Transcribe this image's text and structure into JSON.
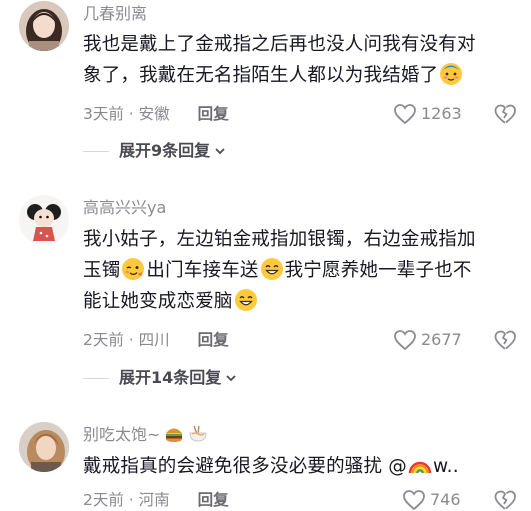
{
  "comments": [
    {
      "username": "几春别离",
      "text1": "我也是戴上了金戒指之后再也没人问我有没有对",
      "text2": "象了，我戴在无名指陌生人都以为我结婚了",
      "time_location": "3天前 · 安徽",
      "reply_label": "回复",
      "likes": "1263",
      "expand_label": "展开9条回复",
      "emoji": [
        "blush-face-emoji"
      ]
    },
    {
      "username": "高高兴兴ya",
      "text1": "我小姑子，左边铂金戒指加银镯，右边金戒指加",
      "text2a": "玉镯",
      "text2b": "出门车接车送",
      "text2c": "我宁愿养她一辈子也不",
      "text3": "能让她变成恋爱脑",
      "time_location": "2天前 · 四川",
      "reply_label": "回复",
      "likes": "2677",
      "expand_label": "展开14条回复",
      "emoji": [
        "wink-face-emoji",
        "grin-face-emoji",
        "grin-face-emoji"
      ]
    },
    {
      "username": "别吃太饱~",
      "username_emoji": [
        "burger-emoji",
        "noodle-bowl-emoji"
      ],
      "text1": "戴戒指真的会避免很多没必要的骚扰 @",
      "text1_tail": "w..",
      "time_location": "2天前 · 河南",
      "reply_label": "回复",
      "likes": "746",
      "emoji": [
        "rainbow-emoji"
      ]
    }
  ],
  "colors": {
    "text": "#161823",
    "meta": "#8a8b91",
    "background": "#ffffff"
  }
}
